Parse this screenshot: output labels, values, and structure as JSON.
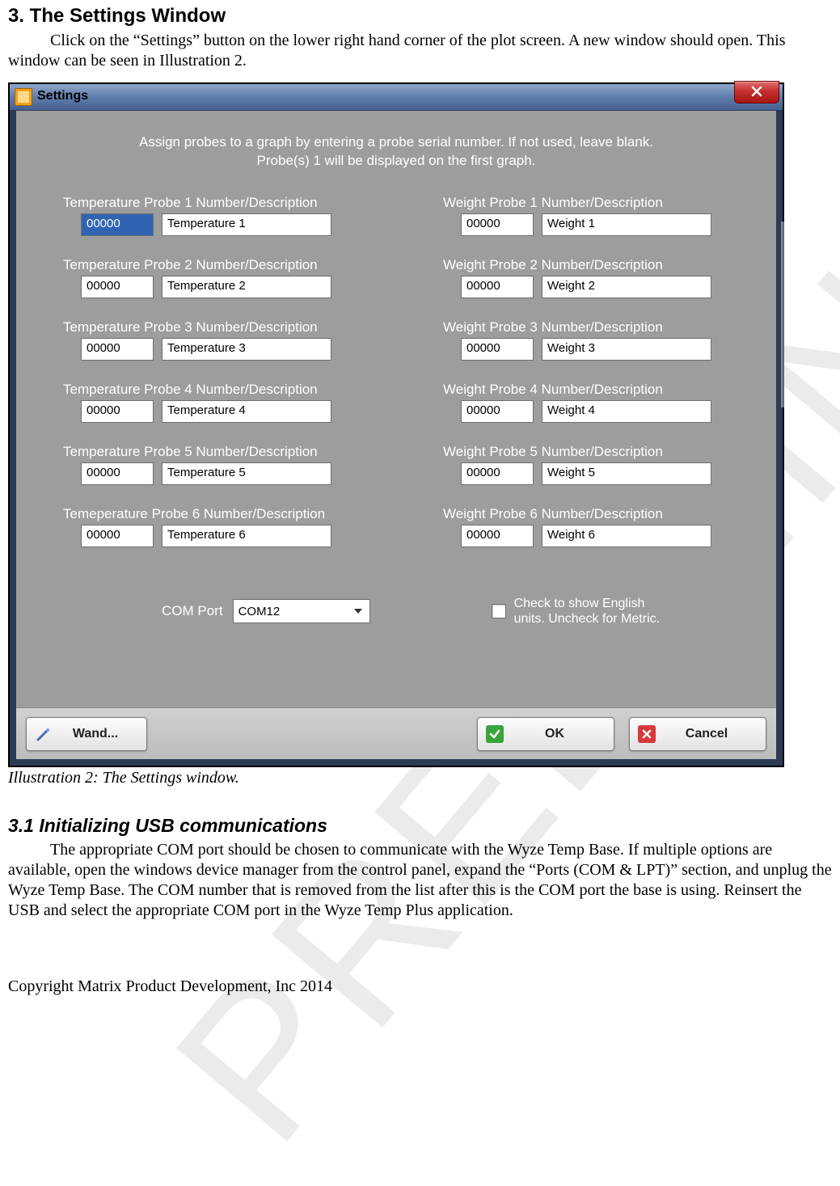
{
  "section_heading": "3. The Settings Window",
  "section_para": "Click on the “Settings” button on the lower right hand corner of the plot screen. A new window should open. This window can be seen in Illustration 2.",
  "illustration_caption": "Illustration 2: The Settings window.",
  "sub_heading": "3.1 Initializing USB communications",
  "sub_para": "The appropriate COM port should be chosen to communicate with the Wyze Temp Base. If multiple options are available, open the windows device manager from the control panel, expand the “Ports (COM & LPT)” section, and unplug the Wyze Temp Base. The COM number that is removed from the list after this is the COM port the base is using. Reinsert the USB and select the appropriate COM port in the Wyze Temp Plus application.",
  "footer": "Copyright Matrix Product Development, Inc 2014",
  "watermark": "PRELIMINARY",
  "window": {
    "title": "Settings",
    "instruction_l1": "Assign probes to a graph by entering a probe serial number. If not used, leave blank.",
    "instruction_l2": "Probe(s) 1 will be displayed on the first graph.",
    "temperature": [
      {
        "label": "Temperature Probe 1 Number/Description",
        "num": "00000",
        "desc": "Temperature 1"
      },
      {
        "label": "Temperature Probe 2 Number/Description",
        "num": "00000",
        "desc": "Temperature 2"
      },
      {
        "label": "Temperature Probe 3 Number/Description",
        "num": "00000",
        "desc": "Temperature 3"
      },
      {
        "label": "Temperature Probe 4 Number/Description",
        "num": "00000",
        "desc": "Temperature 4"
      },
      {
        "label": "Temperature Probe 5 Number/Description",
        "num": "00000",
        "desc": "Temperature 5"
      },
      {
        "label": "Temeperature Probe 6 Number/Description",
        "num": "00000",
        "desc": "Temperature 6"
      }
    ],
    "weight": [
      {
        "label": "Weight Probe 1 Number/Description",
        "num": "00000",
        "desc": "Weight 1"
      },
      {
        "label": "Weight Probe 2 Number/Description",
        "num": "00000",
        "desc": "Weight 2"
      },
      {
        "label": "Weight Probe 3 Number/Description",
        "num": "00000",
        "desc": "Weight 3"
      },
      {
        "label": "Weight Probe 4 Number/Description",
        "num": "00000",
        "desc": "Weight 4"
      },
      {
        "label": "Weight Probe 5 Number/Description",
        "num": "00000",
        "desc": "Weight 5"
      },
      {
        "label": "Weight Probe 6 Number/Description",
        "num": "00000",
        "desc": "Weight 6"
      }
    ],
    "com_port_label": "COM Port",
    "com_port_value": "COM12",
    "units_checkbox_label_l1": "Check to show English",
    "units_checkbox_label_l2": "units. Uncheck for Metric.",
    "buttons": {
      "wand": "Wand...",
      "ok": "OK",
      "cancel": "Cancel"
    }
  }
}
